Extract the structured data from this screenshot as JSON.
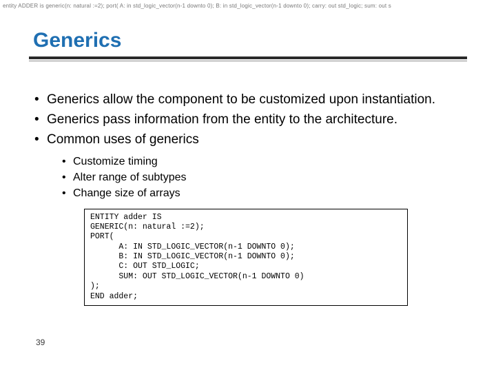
{
  "watermark": "entity ADDER is generic(n: natural :=2); port( A: in std_logic_vector(n-1 downto 0); B: in std_logic_vector(n-1 downto 0); carry: out std_logic; sum: out s",
  "title": "Generics",
  "bullets": {
    "b1": "Generics allow the component to be customized upon instantiation.",
    "b2": "Generics pass information from the entity to the architecture.",
    "b3": "Common uses of generics",
    "sub": {
      "s1": "Customize timing",
      "s2": "Alter range of subtypes",
      "s3": "Change size of arrays"
    }
  },
  "code": "ENTITY adder IS\nGENERIC(n: natural :=2);\nPORT(\n      A: IN STD_LOGIC_VECTOR(n-1 DOWNTO 0);\n      B: IN STD_LOGIC_VECTOR(n-1 DOWNTO 0);\n      C: OUT STD_LOGIC;\n      SUM: OUT STD_LOGIC_VECTOR(n-1 DOWNTO 0)\n);\nEND adder;",
  "slideNumber": "39"
}
